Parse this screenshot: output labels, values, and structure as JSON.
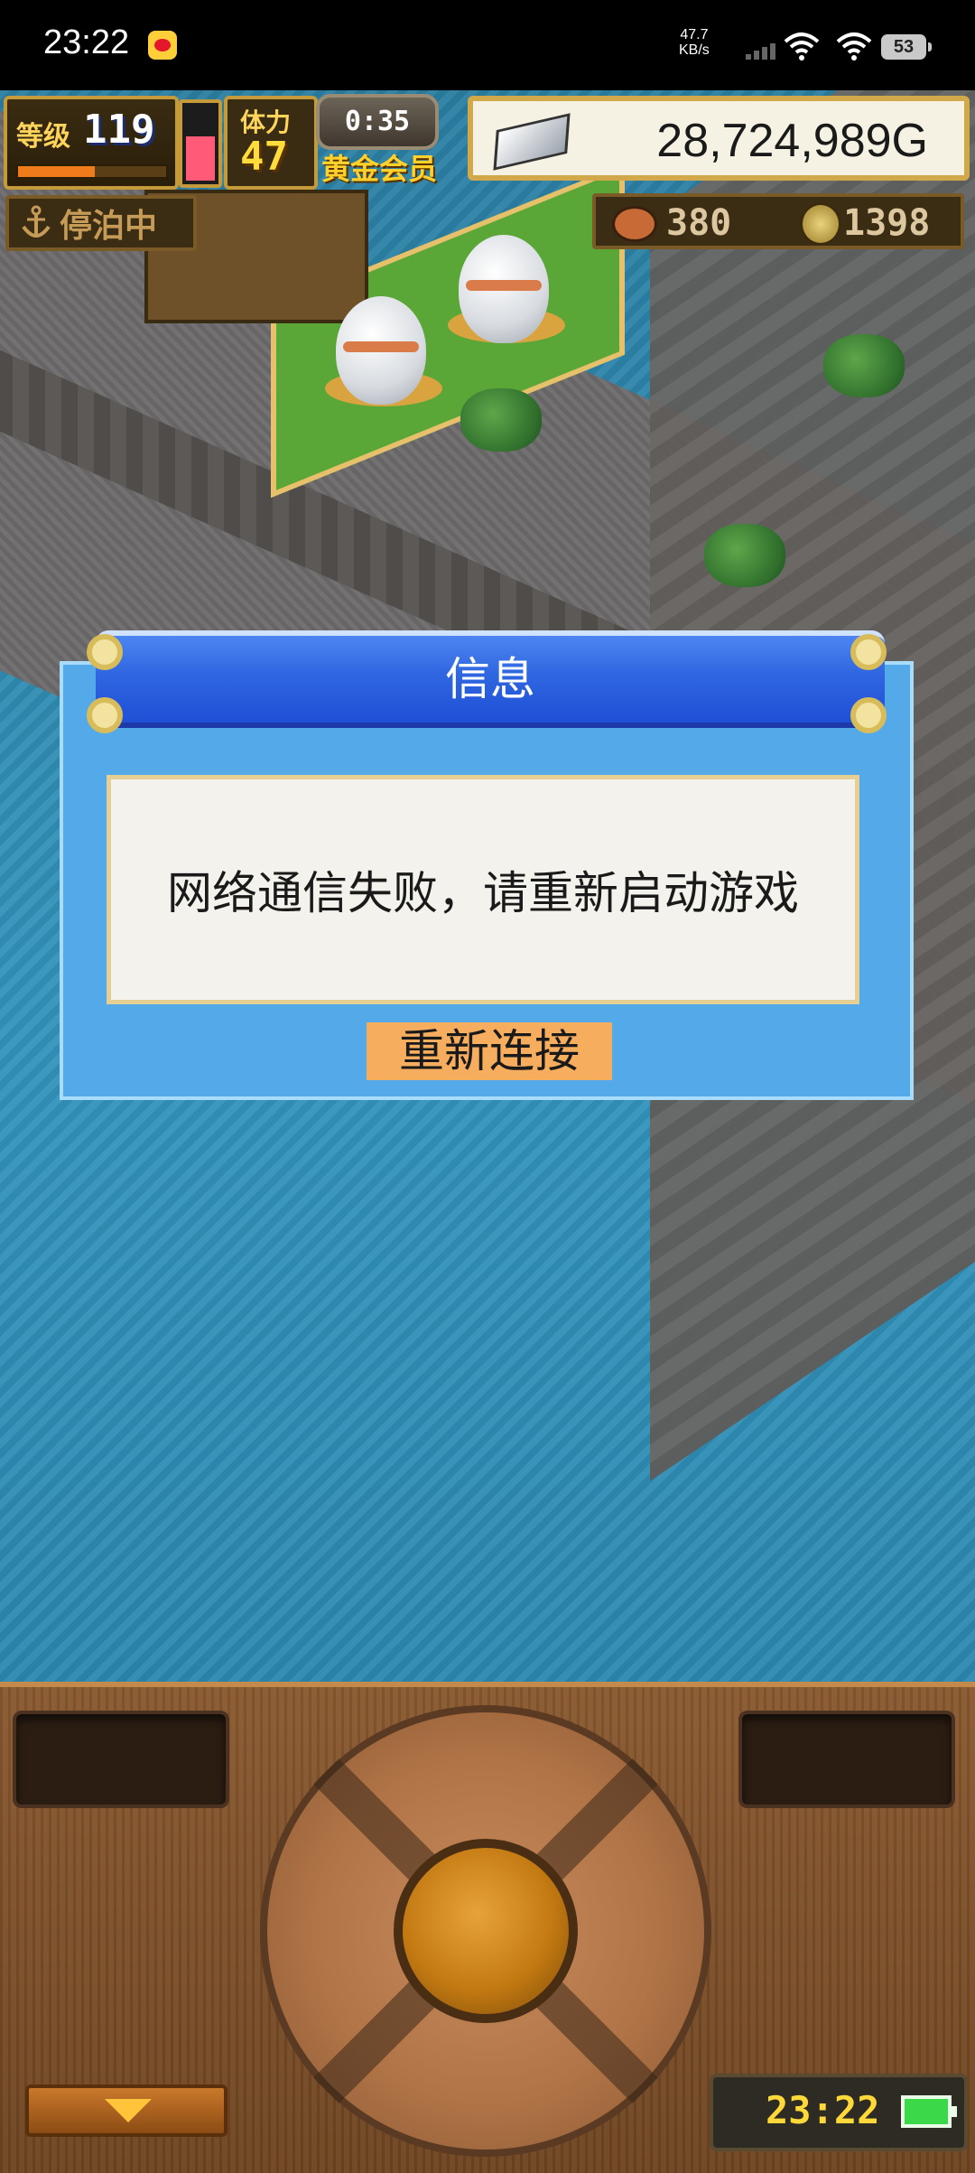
{
  "status_bar": {
    "time": "23:22",
    "net_speed_value": "47.7",
    "net_speed_unit": "KB/s",
    "battery": "53"
  },
  "hud": {
    "level_label": "等级",
    "level_value": "119",
    "stamina_label": "体力",
    "stamina_value": "47",
    "timer": "0:35",
    "membership": "黄金会员",
    "money": "28,724,989G",
    "dock_status": "停泊中",
    "food_count": "380",
    "coin_count": "1398"
  },
  "dialog": {
    "title": "信息",
    "message": "网络通信失败，请重新启动游戏",
    "button_label": "重新连接"
  },
  "bottom_panel": {
    "clock": "23:22"
  },
  "colors": {
    "dialog_bg": "#54a9e8",
    "dialog_title_bg": "#2f66e0",
    "dialog_button_bg": "#f6ad5e",
    "money_text": "#1a1a1a",
    "clock_text": "#ffd93a"
  },
  "icons": [
    "weibo-icon",
    "signal-icon",
    "wifi-icon",
    "battery-icon",
    "silver-ingot-icon",
    "anchor-icon",
    "meat-icon",
    "coin-icon",
    "down-arrow-icon"
  ]
}
